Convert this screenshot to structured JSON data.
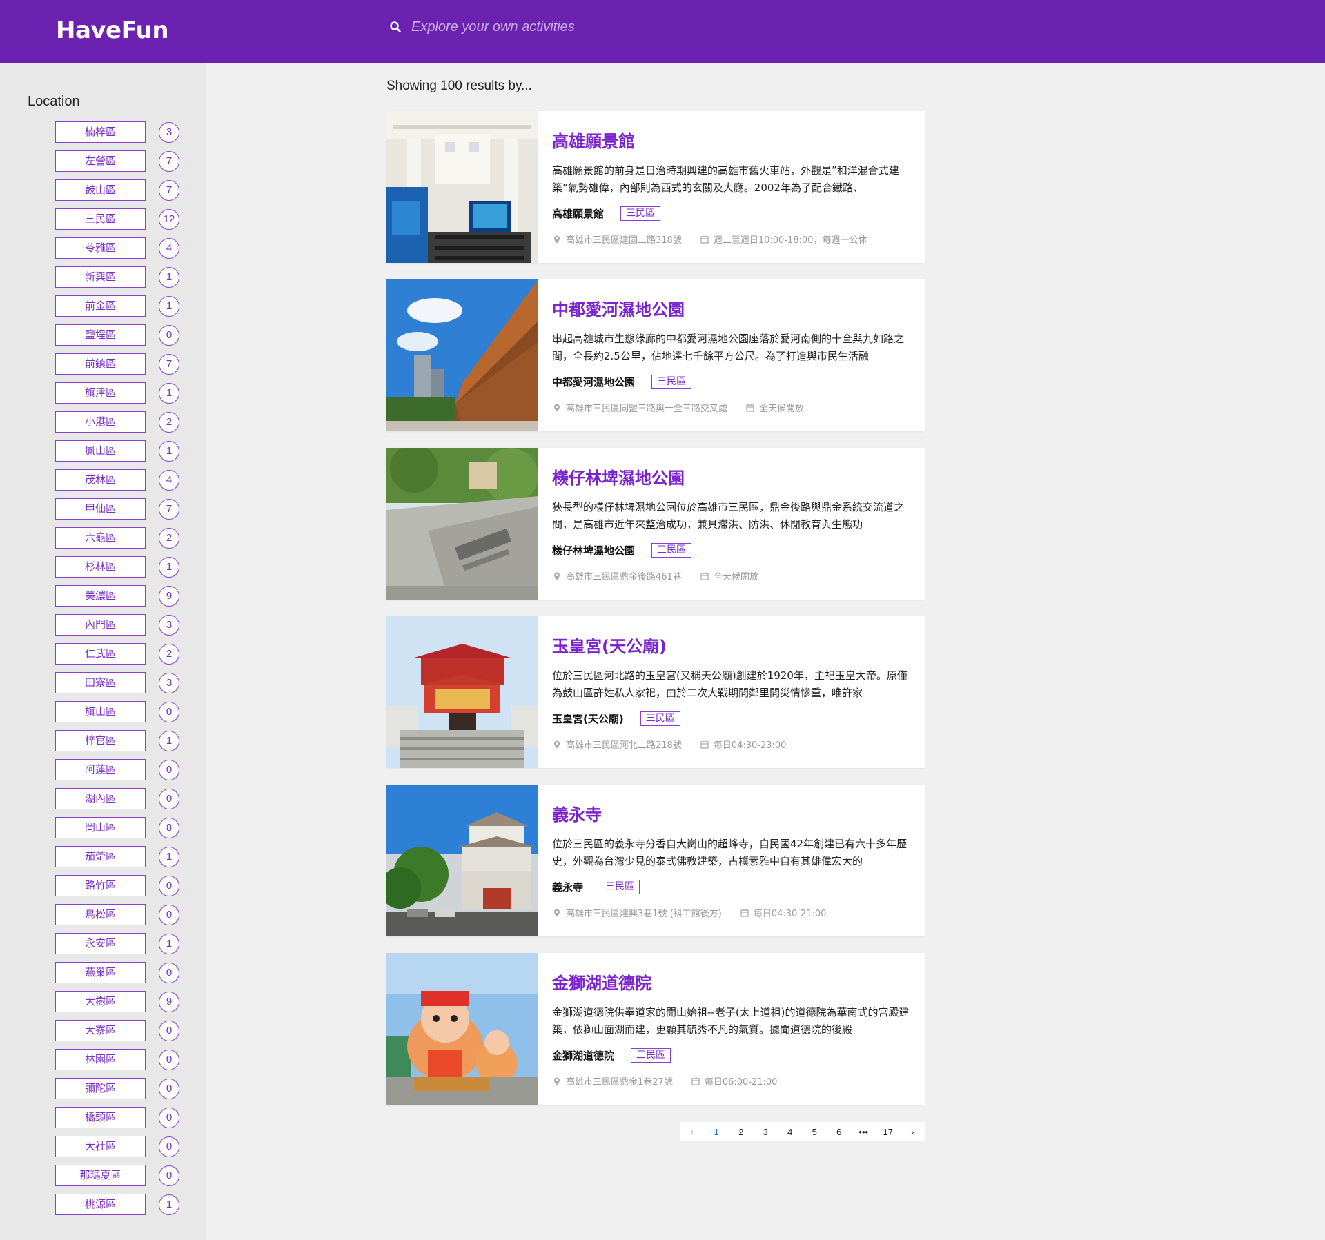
{
  "header": {
    "logo": "HaveFun",
    "search_placeholder": "Explore your own activities"
  },
  "sidebar": {
    "title": "Location",
    "locations": [
      {
        "name": "楠梓區",
        "count": "3"
      },
      {
        "name": "左營區",
        "count": "7"
      },
      {
        "name": "鼓山區",
        "count": "7"
      },
      {
        "name": "三民區",
        "count": "12"
      },
      {
        "name": "苓雅區",
        "count": "4"
      },
      {
        "name": "新興區",
        "count": "1"
      },
      {
        "name": "前金區",
        "count": "1"
      },
      {
        "name": "鹽埕區",
        "count": "0"
      },
      {
        "name": "前鎮區",
        "count": "7"
      },
      {
        "name": "旗津區",
        "count": "1"
      },
      {
        "name": "小港區",
        "count": "2"
      },
      {
        "name": "鳳山區",
        "count": "1"
      },
      {
        "name": "茂林區",
        "count": "4"
      },
      {
        "name": "甲仙區",
        "count": "7"
      },
      {
        "name": "六龜區",
        "count": "2"
      },
      {
        "name": "杉林區",
        "count": "1"
      },
      {
        "name": "美濃區",
        "count": "9"
      },
      {
        "name": "內門區",
        "count": "3"
      },
      {
        "name": "仁武區",
        "count": "2"
      },
      {
        "name": "田寮區",
        "count": "3"
      },
      {
        "name": "旗山區",
        "count": "0"
      },
      {
        "name": "梓官區",
        "count": "1"
      },
      {
        "name": "阿蓮區",
        "count": "0"
      },
      {
        "name": "湖內區",
        "count": "0"
      },
      {
        "name": "岡山區",
        "count": "8"
      },
      {
        "name": "茄萣區",
        "count": "1"
      },
      {
        "name": "路竹區",
        "count": "0"
      },
      {
        "name": "鳥松區",
        "count": "0"
      },
      {
        "name": "永安區",
        "count": "1"
      },
      {
        "name": "燕巢區",
        "count": "0"
      },
      {
        "name": "大樹區",
        "count": "9"
      },
      {
        "name": "大寮區",
        "count": "0"
      },
      {
        "name": "林園區",
        "count": "0"
      },
      {
        "name": "彌陀區",
        "count": "0"
      },
      {
        "name": "橋頭區",
        "count": "0"
      },
      {
        "name": "大社區",
        "count": "0"
      },
      {
        "name": "那瑪夏區",
        "count": "0"
      },
      {
        "name": "桃源區",
        "count": "1"
      }
    ]
  },
  "results": {
    "summary": "Showing 100 results by...",
    "items": [
      {
        "title": "高雄願景館",
        "description": "高雄願景館的前身是日治時期興建的高雄市舊火車站，外觀是”和洋混合式建築”氣勢雄偉，內部則為西式的玄關及大廳。2002年為了配合鐵路、",
        "name": "高雄願景館",
        "tag": "三民區",
        "address": "高雄市三民區建國二路318號",
        "hours": "週二至週日10:00-18:00，每週一公休"
      },
      {
        "title": "中都愛河濕地公園",
        "description": "串起高雄城市生態綠廊的中都愛河濕地公園座落於愛河南側的十全與九如路之間，全長約2.5公里，佔地達七千餘平方公尺。為了打造與市民生活融",
        "name": "中都愛河濕地公園",
        "tag": "三民區",
        "address": "高雄市三民區同盟三路與十全三路交叉處",
        "hours": "全天候開放"
      },
      {
        "title": "檨仔林埤濕地公園",
        "description": "狹長型的檨仔林埤濕地公園位於高雄市三民區，鼎金後路與鼎金系統交流道之間，是高雄市近年來整治成功，兼具滯洪、防洪、休閒教育與生態功",
        "name": "檨仔林埤濕地公園",
        "tag": "三民區",
        "address": "高雄市三民區鼎金後路461巷",
        "hours": "全天候開放"
      },
      {
        "title": "玉皇宮(天公廟)",
        "description": "位於三民區河北路的玉皇宮(又稱天公廟)創建於1920年，主祀玉皇大帝。原僅為鼓山區許姓私人家祀，由於二次大戰期間鄰里間災情慘重，唯許家",
        "name": "玉皇宮(天公廟)",
        "tag": "三民區",
        "address": "高雄市三民區河北二路218號",
        "hours": "每日04:30-23:00"
      },
      {
        "title": "義永寺",
        "description": "位於三民區的義永寺分香自大崗山的超峰寺，自民國42年創建已有六十多年歷史，外觀為台灣少見的泰式佛教建築，古樸素雅中自有其雄偉宏大的",
        "name": "義永寺",
        "tag": "三民區",
        "address": "高雄市三民區建興3巷1號 (科工館後方)",
        "hours": "每日04:30-21:00"
      },
      {
        "title": "金獅湖道德院",
        "description": "金獅湖道德院供奉道家的開山始祖--老子(太上道祖)的道德院為華南式的宮殿建築，依獅山面湖而建，更顯其毓秀不凡的氣質。據聞道德院的後殿",
        "name": "金獅湖道德院",
        "tag": "三民區",
        "address": "高雄市三民區鼎金1巷27號",
        "hours": "每日06:00-21:00"
      }
    ]
  },
  "pagination": {
    "prev": "‹",
    "pages": [
      "1",
      "2",
      "3",
      "4",
      "5",
      "6"
    ],
    "ellipsis": "•••",
    "last": "17",
    "next": "›",
    "current": "1"
  },
  "colors": {
    "header_bg": "#6c22b0",
    "accent": "#7b22d1",
    "sidebar_bg": "#e8e8e8",
    "page_bg": "#f0f0f0"
  }
}
